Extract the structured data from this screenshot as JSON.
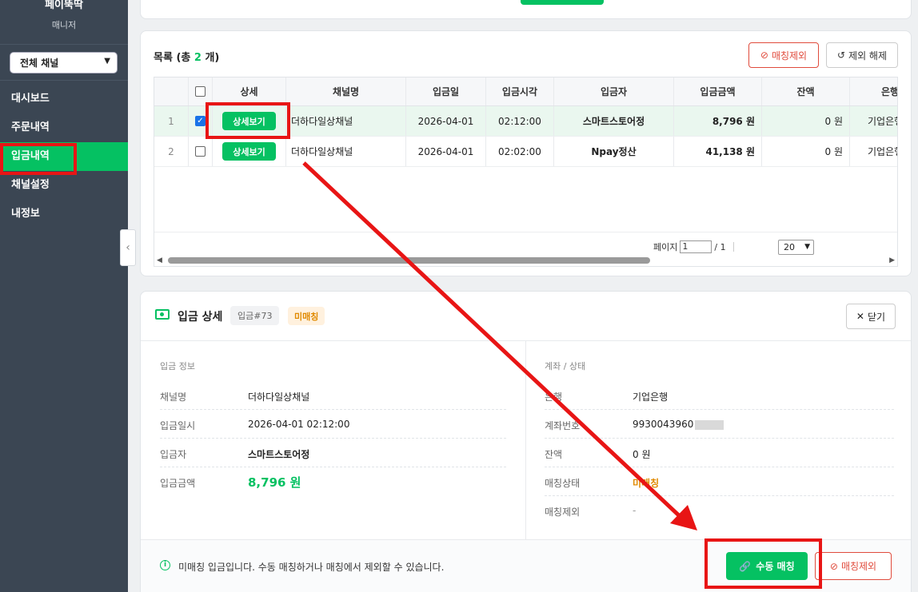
{
  "sidebar": {
    "brand_name": "페이뚝딱",
    "brand_sub": "매니저",
    "channel_select": "전체 채널",
    "items": [
      {
        "label": "대시보드"
      },
      {
        "label": "주문내역"
      },
      {
        "label": "입금내역"
      },
      {
        "label": "채널설정"
      },
      {
        "label": "내정보"
      }
    ]
  },
  "list": {
    "title_prefix": "목록 (총 ",
    "count": "2",
    "title_suffix": " 개)",
    "exclude_label": "매칭제외",
    "release_label": "제외 해제",
    "columns": [
      "상세",
      "채널명",
      "입금일",
      "입금시각",
      "입금자",
      "입금금액",
      "잔액",
      "은행"
    ],
    "rows": [
      {
        "num": "1",
        "checked": true,
        "detail": "상세보기",
        "channel": "더하다일상채널",
        "date": "2026-04-01",
        "time": "02:12:00",
        "depositor": "스마트스토어정",
        "amount": "8,796 원",
        "balance": "0 원",
        "bank": "기업은행"
      },
      {
        "num": "2",
        "checked": false,
        "detail": "상세보기",
        "channel": "더하다일상채널",
        "date": "2026-04-01",
        "time": "02:02:00",
        "depositor": "Npay정산",
        "amount": "41,138 원",
        "balance": "0 원",
        "bank": "기업은행"
      }
    ],
    "pager_label": "페이지",
    "page_current": "1",
    "page_total": "/ 1",
    "page_size": "20"
  },
  "detail": {
    "title": "입금 상세",
    "id_tag": "입금#73",
    "status_tag": "미매칭",
    "close_label": "닫기",
    "left_section": "입금 정보",
    "right_section": "계좌 / 상태",
    "left": {
      "channel_k": "채널명",
      "channel_v": "더하다일상채널",
      "datetime_k": "입금일시",
      "datetime_v": "2026-04-01 02:12:00",
      "depositor_k": "입금자",
      "depositor_v": "스마트스토어정",
      "amount_k": "입금금액",
      "amount_v": "8,796 원"
    },
    "right": {
      "bank_k": "은행",
      "bank_v": "기업은행",
      "account_k": "계좌번호",
      "account_v": "9930043960",
      "balance_k": "잔액",
      "balance_v": "0 원",
      "match_k": "매칭상태",
      "match_v": "미매칭",
      "excluded_k": "매칭제외",
      "excluded_v": "-"
    },
    "foot_message": "미매칭 입금입니다. 수동 매칭하거나 매칭에서 제외할 수 있습니다.",
    "manual_match_label": "수동 매칭",
    "exclude_label": "매칭제외"
  },
  "colors": {
    "accent": "#05c162",
    "sidebar_bg": "#3b4653",
    "danger": "#e04b3c",
    "annotation": "#e81515"
  }
}
